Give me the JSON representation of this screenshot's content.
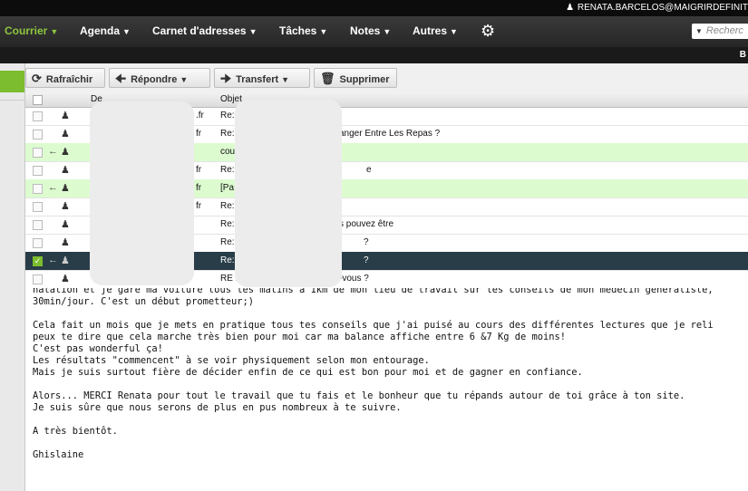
{
  "user": {
    "email": "RENATA.BARCELOS@MAIGRIRDEFINIT"
  },
  "nav": {
    "items": [
      "Courrier",
      "Agenda",
      "Carnet d'adresses",
      "Tâches",
      "Notes",
      "Autres"
    ],
    "search_placeholder": "Recherc"
  },
  "subbar": {
    "label": "B"
  },
  "toolbar": {
    "refresh": "Rafraîchir",
    "reply": "Répondre",
    "forward": "Transfert",
    "delete": "Supprimer"
  },
  "list": {
    "col_from": "De",
    "col_subject": "Objet",
    "rows": [
      {
        "from": ".fr",
        "subject": "Re:",
        "subject_tail": "",
        "replied": false,
        "style": "normal"
      },
      {
        "from": "fr",
        "subject": "Re:",
        "subject_tail": "anger Entre Les Repas ?",
        "replied": false,
        "style": "normal"
      },
      {
        "from": "",
        "subject": "cou",
        "subject_tail": "",
        "replied": true,
        "style": "green"
      },
      {
        "from": "fr",
        "subject": "Re:",
        "subject_tail": "e",
        "replied": false,
        "style": "normal"
      },
      {
        "from": "fr",
        "subject": "[Pa",
        "subject_tail": "",
        "replied": true,
        "style": "green"
      },
      {
        "from": "fr",
        "subject": "Re:",
        "subject_tail": "",
        "replied": false,
        "style": "normal"
      },
      {
        "from": "",
        "subject": "Re:",
        "subject_tail": "s pouvez être",
        "replied": false,
        "style": "normal"
      },
      {
        "from": "",
        "subject": "Re:",
        "subject_tail": "?",
        "replied": false,
        "style": "normal"
      },
      {
        "from": "",
        "subject": "Re:",
        "subject_tail": "?",
        "replied": true,
        "style": "selected"
      },
      {
        "from": "",
        "subject": "RE :",
        "subject_tail": "-vous ?",
        "replied": false,
        "style": "normal"
      }
    ]
  },
  "message": {
    "lines": [
      "natation et je gare ma voiture tous les matins à 1km de mon lieu de travail sur les conseils de mon médecin généraliste,",
      "30min/jour. C'est un début prometteur;)",
      "",
      "Cela fait un mois que je mets en pratique tous tes conseils que j'ai puisé au cours des différentes lectures que je reli",
      "peux te dire que cela marche très bien pour moi car ma balance affiche entre 6 &7 Kg de moins!",
      "C'est pas wonderful ça!",
      "Les résultats \"commencent\" à se voir physiquement selon mon entourage.",
      "Mais je suis surtout fière de décider enfin de ce qui est bon pour moi et de gagner en confiance.",
      "",
      "Alors... MERCI Renata pour tout le travail que tu fais et le bonheur que tu répands autour de toi grâce à ton site.",
      "Je suis sûre que nous serons de plus en pus nombreux à te suivre.",
      "",
      "A très bientôt.",
      "",
      "Ghislaine"
    ]
  },
  "colors": {
    "accent_green": "#7cbd2f",
    "row_green": "#dcfcd0",
    "row_selected": "#283d48"
  }
}
